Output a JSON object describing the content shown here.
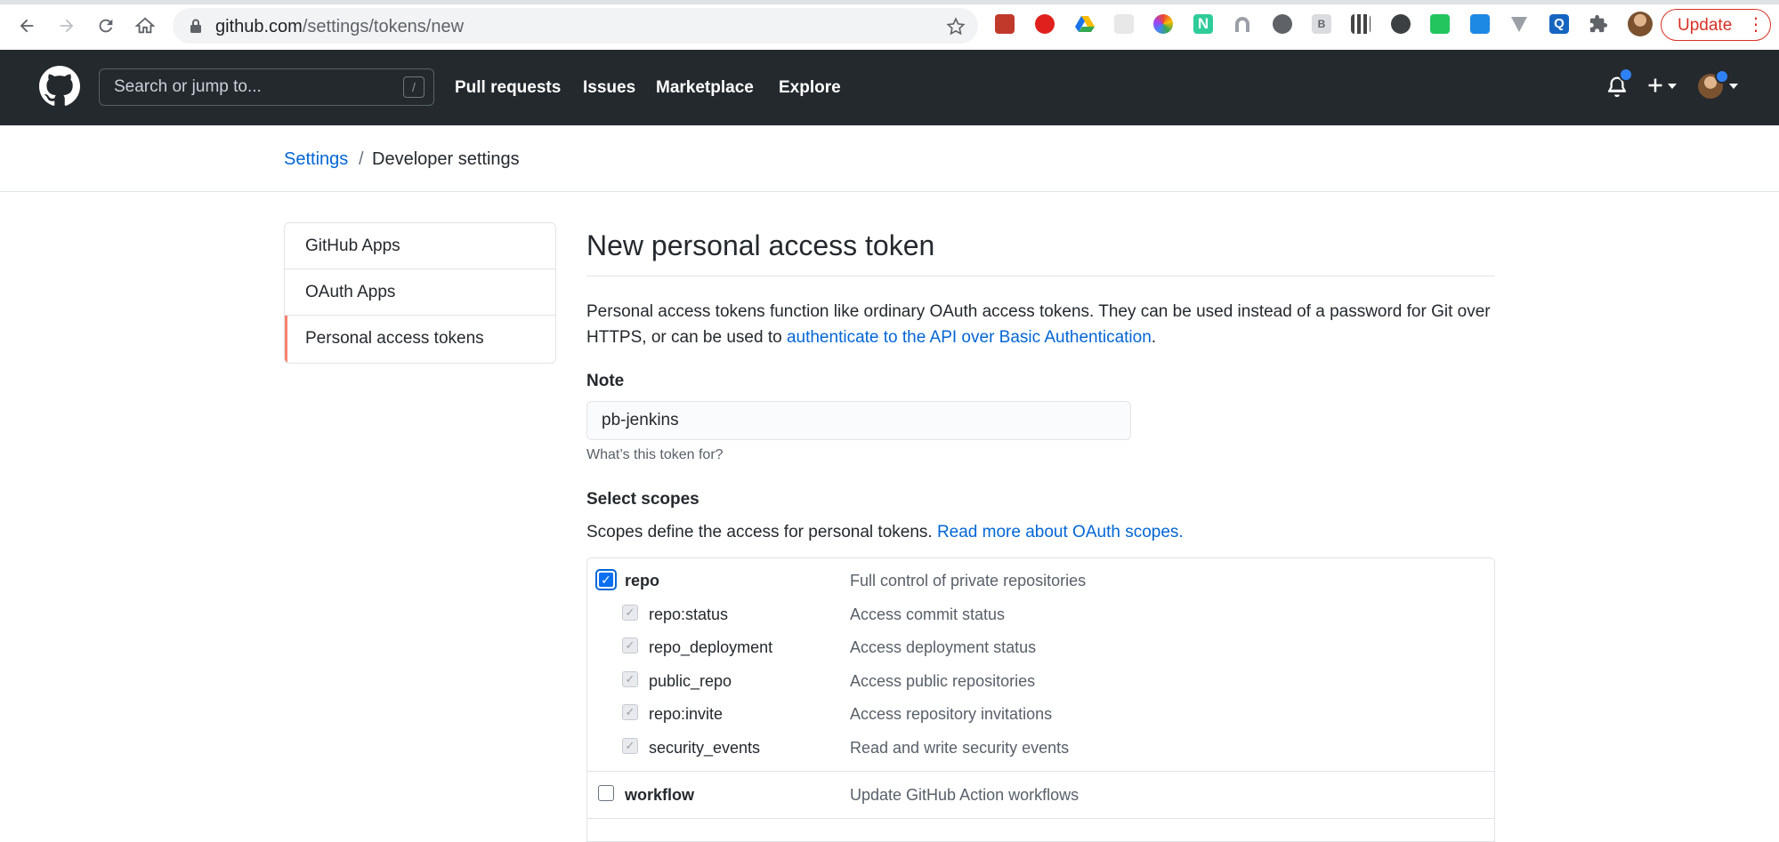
{
  "browser": {
    "url_host": "github.com",
    "url_path": "/settings/tokens/new",
    "update_label": "Update",
    "menu_glyph": "⋮"
  },
  "header": {
    "search_placeholder": "Search or jump to...",
    "search_shortcut": "/",
    "nav": [
      "Pull requests",
      "Issues",
      "Marketplace",
      "Explore"
    ]
  },
  "breadcrumb": {
    "settings": "Settings",
    "separator": "/",
    "current": "Developer settings"
  },
  "sidebar": {
    "items": [
      {
        "label": "GitHub Apps"
      },
      {
        "label": "OAuth Apps"
      },
      {
        "label": "Personal access tokens",
        "selected": true
      }
    ]
  },
  "main": {
    "title": "New personal access token",
    "desc_text": "Personal access tokens function like ordinary OAuth access tokens. They can be used instead of a password for Git over HTTPS, or can be used to ",
    "desc_link": "authenticate to the API over Basic Authentication",
    "desc_end": ".",
    "note_label": "Note",
    "note_value": "pb-jenkins",
    "note_hint": "What’s this token for?",
    "scopes_heading": "Select scopes",
    "scopes_text": "Scopes define the access for personal tokens. ",
    "scopes_link": "Read more about OAuth scopes."
  },
  "scopes": {
    "repo": {
      "name": "repo",
      "desc": "Full control of private repositories",
      "checked": true
    },
    "repo_subs": [
      {
        "name": "repo:status",
        "desc": "Access commit status"
      },
      {
        "name": "repo_deployment",
        "desc": "Access deployment status"
      },
      {
        "name": "public_repo",
        "desc": "Access public repositories"
      },
      {
        "name": "repo:invite",
        "desc": "Access repository invitations"
      },
      {
        "name": "security_events",
        "desc": "Read and write security events"
      }
    ],
    "workflow": {
      "name": "workflow",
      "desc": "Update GitHub Action workflows",
      "checked": false
    }
  },
  "colors": {
    "header_bg": "#24292e",
    "link": "#0366d6",
    "selected_accent": "#f9826c",
    "update_red": "#d93025"
  }
}
